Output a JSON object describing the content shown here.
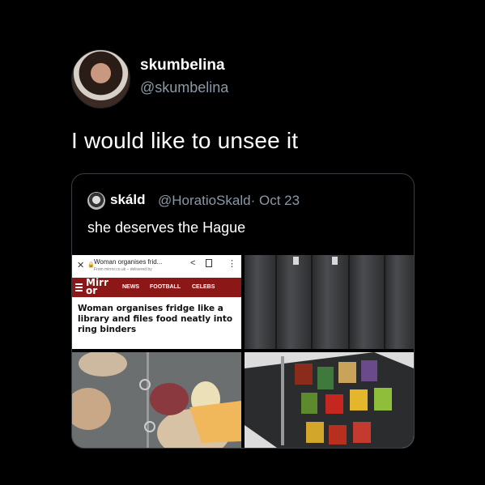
{
  "tweet": {
    "display_name": "skumbelina",
    "handle": "@skumbelina",
    "text": "I would like to unsee it"
  },
  "quote": {
    "name": "skáld",
    "meta": "@HoratioSkald· Oct 23",
    "text": "she deserves the Hague"
  },
  "article": {
    "browser_title": "Woman organises frid...",
    "browser_sub": "From mirror.co.uk – delivered by",
    "logo": "Mirr or",
    "nav": [
      "NEWS",
      "FOOTBALL",
      "CELEBS"
    ],
    "headline": "Woman organises fridge like a library and files food neatly into ring binders"
  },
  "colors": {
    "background": "#000000",
    "muted": "#8b98a5",
    "mirror_red": "#8b1717"
  }
}
